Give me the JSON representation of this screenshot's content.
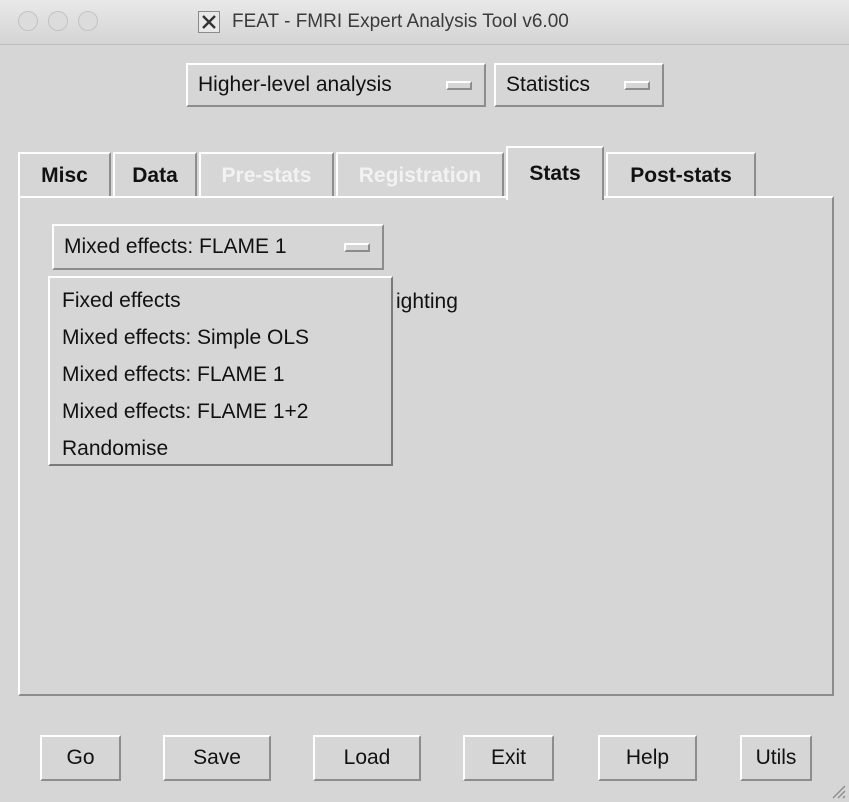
{
  "window": {
    "title": "FEAT - FMRI Expert Analysis Tool v6.00",
    "title_icon": "x11-icon"
  },
  "top_menus": {
    "analysis_level": "Higher-level analysis",
    "analysis_type": "Statistics"
  },
  "tabs": [
    {
      "label": "Misc",
      "state": "normal"
    },
    {
      "label": "Data",
      "state": "normal"
    },
    {
      "label": "Pre-stats",
      "state": "disabled"
    },
    {
      "label": "Registration",
      "state": "disabled"
    },
    {
      "label": "Stats",
      "state": "active"
    },
    {
      "label": "Post-stats",
      "state": "normal"
    }
  ],
  "stats": {
    "mixed_effects_selected": "Mixed effects: FLAME 1",
    "partially_hidden_text": "ighting",
    "options": [
      "Fixed effects",
      "Mixed effects: Simple OLS",
      "Mixed effects: FLAME 1",
      "Mixed effects: FLAME 1+2",
      "Randomise"
    ]
  },
  "buttons": {
    "go": "Go",
    "save": "Save",
    "load": "Load",
    "exit": "Exit",
    "help": "Help",
    "utils": "Utils"
  },
  "colors": {
    "background": "#d6d6d6",
    "disabled_text": "#f2f2f2",
    "highlight": "#ffffff",
    "shadow": "#8d8d8d"
  }
}
